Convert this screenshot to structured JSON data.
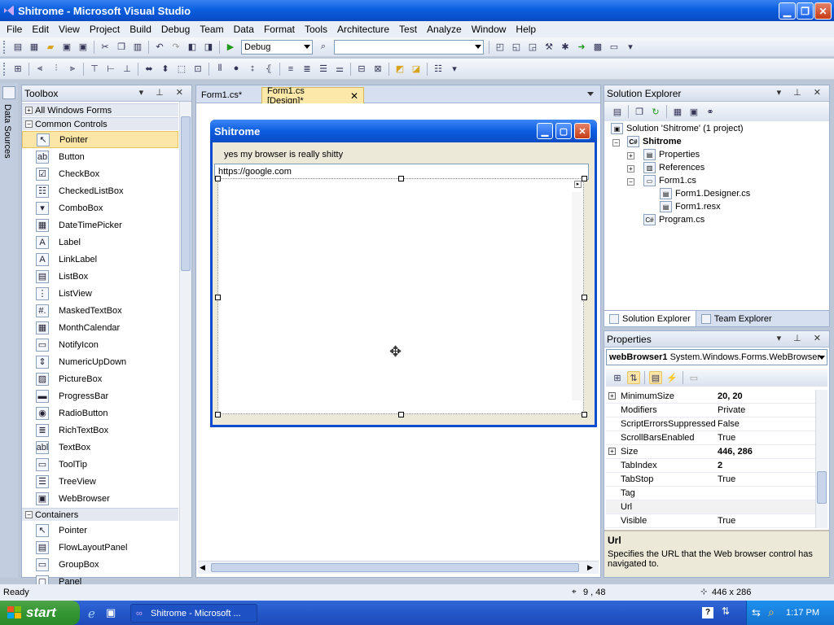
{
  "window": {
    "title": "Shitrome - Microsoft Visual Studio"
  },
  "menu": [
    "File",
    "Edit",
    "View",
    "Project",
    "Build",
    "Debug",
    "Team",
    "Data",
    "Format",
    "Tools",
    "Architecture",
    "Test",
    "Analyze",
    "Window",
    "Help"
  ],
  "toolbar": {
    "config_value": "Debug",
    "platform_value": ""
  },
  "side_strip": {
    "label": "Data Sources"
  },
  "toolbox": {
    "title": "Toolbox",
    "sections": {
      "all": "All Windows Forms",
      "common": "Common Controls",
      "containers": "Containers"
    },
    "common_items": [
      "Pointer",
      "Button",
      "CheckBox",
      "CheckedListBox",
      "ComboBox",
      "DateTimePicker",
      "Label",
      "LinkLabel",
      "ListBox",
      "ListView",
      "MaskedTextBox",
      "MonthCalendar",
      "NotifyIcon",
      "NumericUpDown",
      "PictureBox",
      "ProgressBar",
      "RadioButton",
      "RichTextBox",
      "TextBox",
      "ToolTip",
      "TreeView",
      "WebBrowser"
    ],
    "container_items": [
      "Pointer",
      "FlowLayoutPanel",
      "GroupBox",
      "Panel"
    ]
  },
  "tabs": {
    "tab1": "Form1.cs*",
    "tab2": "Form1.cs [Design]*"
  },
  "form": {
    "title": "Shitrome",
    "label": "yes my browser is really shitty",
    "url": "https://google.com"
  },
  "solution_explorer": {
    "title": "Solution Explorer",
    "solution": "Solution 'Shitrome' (1 project)",
    "project": "Shitrome",
    "properties": "Properties",
    "references": "References",
    "form1": "Form1.cs",
    "designer": "Form1.Designer.cs",
    "resx": "Form1.resx",
    "program": "Program.cs",
    "tab_solution": "Solution Explorer",
    "tab_team": "Team Explorer"
  },
  "properties": {
    "title": "Properties",
    "object_name": "webBrowser1",
    "object_type": "System.Windows.Forms.WebBrowser",
    "rows": [
      {
        "name": "MinimumSize",
        "value": "20, 20"
      },
      {
        "name": "Modifiers",
        "value": "Private"
      },
      {
        "name": "ScriptErrorsSuppressed",
        "value": "False"
      },
      {
        "name": "ScrollBarsEnabled",
        "value": "True"
      },
      {
        "name": "Size",
        "value": "446, 286"
      },
      {
        "name": "TabIndex",
        "value": "2"
      },
      {
        "name": "TabStop",
        "value": "True"
      },
      {
        "name": "Tag",
        "value": ""
      },
      {
        "name": "Url",
        "value": ""
      },
      {
        "name": "Visible",
        "value": "True"
      }
    ],
    "desc_title": "Url",
    "desc_text": "Specifies the URL that the Web browser control has navigated to."
  },
  "status": {
    "ready": "Ready",
    "position": "9 , 48",
    "size": "446 x 286"
  },
  "taskbar": {
    "start": "start",
    "task": "Shitrome - Microsoft ...",
    "time": "1:17 PM"
  },
  "colors": {
    "titlebar": "#0a5fdf",
    "selection": "#fbe6a8",
    "taskbar": "#2457ca",
    "start": "#339532"
  }
}
